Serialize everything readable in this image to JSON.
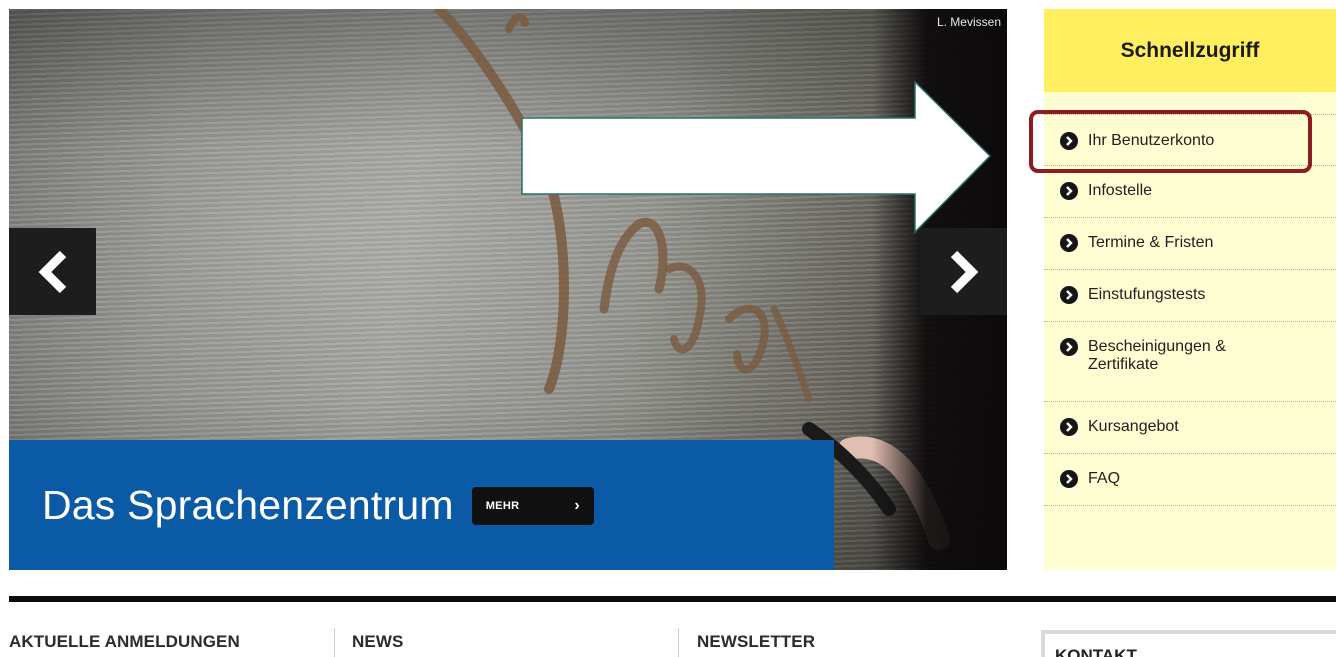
{
  "hero": {
    "credit": "L. Mevissen",
    "caption_title": "Das Sprachenzentrum",
    "more_label": "MEHR",
    "prev_icon": "chevron-left-icon",
    "next_icon": "chevron-right-icon"
  },
  "quick_access": {
    "title": "Schnellzugriff",
    "items": [
      {
        "label": "Ihr Benutzerkonto"
      },
      {
        "label": "Infostelle"
      },
      {
        "label": "Termine & Fristen"
      },
      {
        "label": "Einstufungstests"
      },
      {
        "label": "Bescheinigungen & Zertifikate"
      },
      {
        "label": "Kursangebot"
      },
      {
        "label": "FAQ"
      }
    ],
    "bullet_icon": "circle-chevron-right-icon"
  },
  "sections": {
    "registrations": "AKTUELLE ANMELDUNGEN",
    "news": "NEWS",
    "newsletter": "NEWSLETTER",
    "contact": "KONTAKT"
  },
  "colors": {
    "caption_blue": "#0b5aa5",
    "quick_header_yellow": "#ffef5e",
    "quick_bg": "#fffdd2",
    "highlight_red": "#8c1b22"
  }
}
